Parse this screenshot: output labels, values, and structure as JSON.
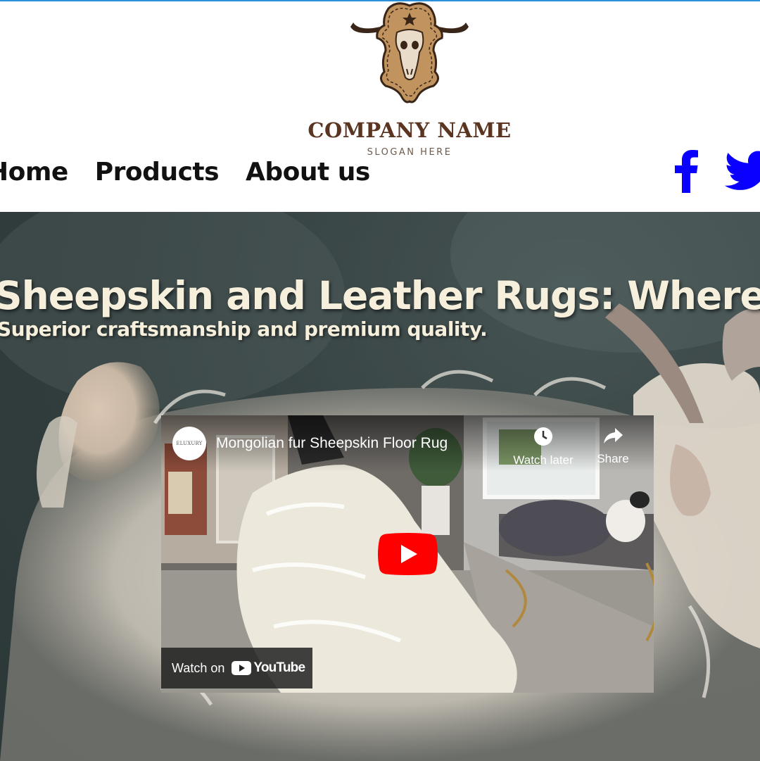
{
  "header": {
    "company_name": "COMPANY NAME",
    "slogan": "SLOGAN HERE",
    "nav": [
      {
        "label": "Home"
      },
      {
        "label": "Products"
      },
      {
        "label": "About us"
      }
    ],
    "social": [
      "facebook-icon",
      "twitter-icon"
    ],
    "social_color": "#0a00ff"
  },
  "hero": {
    "title": "Sheepskin and Leather Rugs: Where Elegance Meets",
    "subtitle": "Superior craftsmanship and premium quality.",
    "title_color": "#f5efdc"
  },
  "video": {
    "channel": "ELUXURY",
    "title": "Mongolian fur Sheepskin Floor Rug",
    "watch_later_label": "Watch later",
    "share_label": "Share",
    "watch_on_label": "Watch on",
    "youtube_label": "YouTube",
    "play_color": "#ff0000"
  },
  "colors": {
    "logo_brown": "#c0935f",
    "company_name": "#5a3522",
    "top_border": "#2a8fd8"
  }
}
